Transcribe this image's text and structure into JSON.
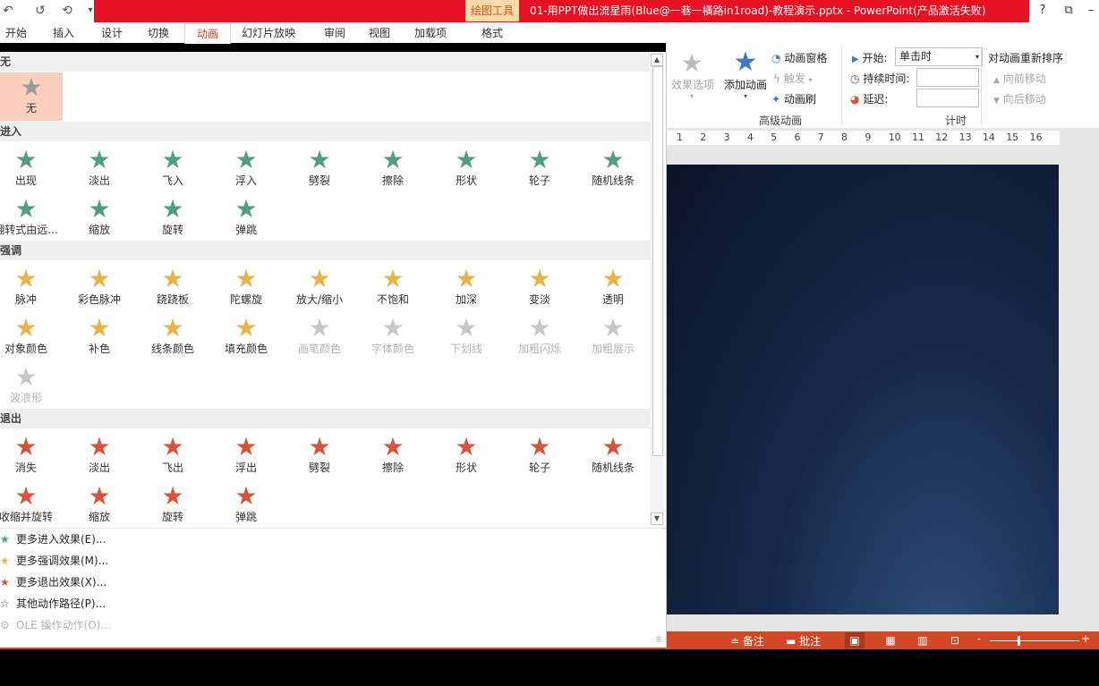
{
  "titlebar": {
    "context_tool": "绘图工具",
    "doc_title": "01-用PPT做出流星雨(Blue@一巷一橫路in1road)-教程演示.pptx -  PowerPoint(产品激活失败)",
    "help": "?"
  },
  "tabs": [
    "开始",
    "插入",
    "设计",
    "切换",
    "动画",
    "幻灯片放映",
    "审阅",
    "视图",
    "加载项",
    "格式"
  ],
  "active_tab": "动画",
  "ribbon": {
    "effect_options": "效果选项",
    "add_animation": "添加动画",
    "anim_pane": "动画窗格",
    "trigger": "触发",
    "anim_painter": "动画刷",
    "group_advanced": "高级动画",
    "start_label": "开始:",
    "start_value": "单击时",
    "duration_label": "持续时间:",
    "delay_label": "延迟:",
    "group_timing": "计时",
    "reorder_title": "对动画重新排序",
    "move_earlier": "向前移动",
    "move_later": "向后移动"
  },
  "ruler": {
    "ticks": [
      "1",
      "2",
      "3",
      "4",
      "5",
      "6",
      "7",
      "8",
      "9",
      "10",
      "11",
      "12",
      "13",
      "14",
      "15",
      "16"
    ]
  },
  "gallery": {
    "sections": {
      "none": "无",
      "entrance": "进入",
      "emphasis": "强调",
      "exit": "退出"
    },
    "none_item": "无",
    "entrance_items": [
      "出现",
      "淡出",
      "飞入",
      "浮入",
      "劈裂",
      "擦除",
      "形状",
      "轮子",
      "随机线条",
      "翻转式由远...",
      "缩放",
      "旋转",
      "弹跳"
    ],
    "emphasis_items": [
      "脉冲",
      "彩色脉冲",
      "跷跷板",
      "陀螺旋",
      "放大/缩小",
      "不饱和",
      "加深",
      "变淡",
      "透明",
      "对象颜色",
      "补色",
      "线条颜色",
      "填充颜色",
      "画笔颜色",
      "字体颜色",
      "下划线",
      "加粗闪烁",
      "加粗展示",
      "波浪形"
    ],
    "exit_items": [
      "消失",
      "淡出",
      "飞出",
      "浮出",
      "劈裂",
      "擦除",
      "形状",
      "轮子",
      "随机线条",
      "收缩并旋转",
      "缩放",
      "旋转",
      "弹跳"
    ],
    "menu": [
      {
        "label": "更多进入效果(E)...",
        "icon": "star-green-icon"
      },
      {
        "label": "更多强调效果(M)...",
        "icon": "star-yellow-icon"
      },
      {
        "label": "更多退出效果(X)...",
        "icon": "star-red-icon"
      },
      {
        "label": "其他动作路径(P)...",
        "icon": "star-outline-icon"
      },
      {
        "label": "OLE 操作动作(O)...",
        "icon": "gear-icon"
      }
    ]
  },
  "statusbar": {
    "notes": "备注",
    "comments": "批注",
    "zoom_minus": "-",
    "zoom_plus": "+"
  },
  "colors": {
    "accent": "#d24726",
    "title_red": "#e81123",
    "entrance": "#4f9e82",
    "emphasis": "#e8b44a",
    "exit": "#d9533b",
    "selected": "#fbcfbc"
  }
}
